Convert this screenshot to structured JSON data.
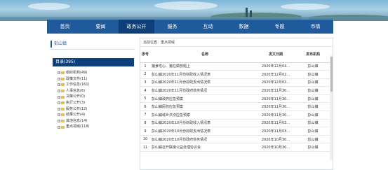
{
  "nav": {
    "items": [
      {
        "label": "首页"
      },
      {
        "label": "要闻"
      },
      {
        "label": "政务公开",
        "active": true
      },
      {
        "label": "服务"
      },
      {
        "label": "互动"
      },
      {
        "label": "数据"
      },
      {
        "label": "专题"
      },
      {
        "label": "市情"
      }
    ]
  },
  "sidebar": {
    "title": "彭山镇",
    "directory_label": "目录(395)",
    "tree": [
      {
        "label": "组织机构(49)"
      },
      {
        "label": "政策文件(11)"
      },
      {
        "label": "工作信息(161)"
      },
      {
        "label": "人事信息(6)"
      },
      {
        "label": "决策公开(0)"
      },
      {
        "label": "执行公开(3)"
      },
      {
        "label": "服务公开(12)"
      },
      {
        "label": "结果公开(4)"
      },
      {
        "label": "其他信息(14)"
      },
      {
        "label": "重点领域(118)"
      }
    ]
  },
  "content": {
    "breadcrumb": "当前位置：重点领域",
    "headers": {
      "no": "序号",
      "title": "名称",
      "date": "发文日期",
      "org": "发布机构"
    },
    "rows": [
      {
        "no": "1",
        "title": "猪食吃心、猪在做放题上",
        "date": "2020年12月04...",
        "org": "彭山镇"
      },
      {
        "no": "2",
        "title": "彭山镇2020年11月份财政收入情况表",
        "date": "2020年12月02...",
        "org": "彭山镇"
      },
      {
        "no": "3",
        "title": "彭山镇2020年11月份财政支出情况表",
        "date": "2020年12月02...",
        "org": "彭山镇"
      },
      {
        "no": "4",
        "title": "彭山镇2020年11月份政府债务情况",
        "date": "2020年11月30...",
        "org": "彭山镇"
      },
      {
        "no": "5",
        "title": "彭山镇政府应急预案",
        "date": "2020年11月30...",
        "org": "彭山镇"
      },
      {
        "no": "6",
        "title": "彭山镇民防应急预案",
        "date": "2020年11月30...",
        "org": "彭山镇"
      },
      {
        "no": "7",
        "title": "彭山镇城乡洪涝应急预案",
        "date": "2020年11月30...",
        "org": "彭山镇"
      },
      {
        "no": "8",
        "title": "彭山镇2020年10月份财政收入情况表",
        "date": "2020年11月03...",
        "org": "彭山镇"
      },
      {
        "no": "9",
        "title": "彭山镇2020年10月份财政支出情况表",
        "date": "2020年11月03...",
        "org": "彭山镇"
      },
      {
        "no": "10",
        "title": "彭山镇2020年10月份政府债务情况",
        "date": "2020年10月30...",
        "org": "彭山镇"
      },
      {
        "no": "11",
        "title": "彭山镇召开联席公益处理协议会",
        "date": "2020年10月30...",
        "org": "彭山镇"
      }
    ]
  },
  "colors": {
    "nav_bg": "#1f5a9c",
    "nav_active": "#0d3f7a",
    "accent": "#0d3f7a"
  }
}
